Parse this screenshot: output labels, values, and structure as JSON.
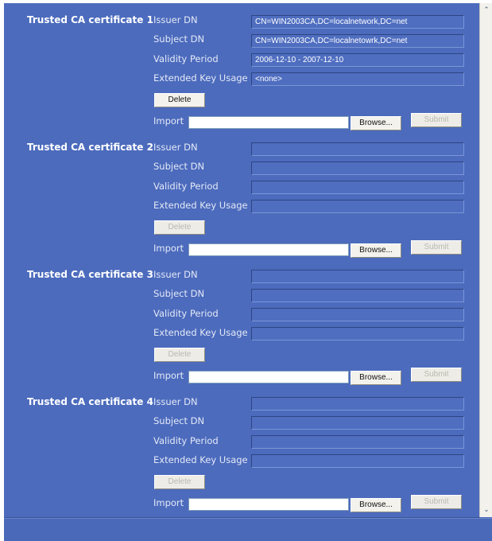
{
  "labels": {
    "issuer_dn": "Issuer DN",
    "subject_dn": "Subject DN",
    "validity_period": "Validity Period",
    "extended_key_usage": "Extended Key Usage",
    "delete": "Delete",
    "import": "Import",
    "browse": "Browse...",
    "submit": "Submit"
  },
  "certificates": [
    {
      "title": "Trusted CA certificate 1",
      "issuer_dn": "CN=WIN2003CA,DC=localnetwork,DC=net",
      "subject_dn": "CN=WIN2003CA,DC=localnetowrk,DC=net",
      "validity_period": "2006-12-10 - 2007-12-10",
      "extended_key_usage": "<none>",
      "delete_enabled": true,
      "submit_enabled": false
    },
    {
      "title": "Trusted CA certificate 2",
      "issuer_dn": "",
      "subject_dn": "",
      "validity_period": "",
      "extended_key_usage": "",
      "delete_enabled": false,
      "submit_enabled": false
    },
    {
      "title": "Trusted CA certificate 3",
      "issuer_dn": "",
      "subject_dn": "",
      "validity_period": "",
      "extended_key_usage": "",
      "delete_enabled": false,
      "submit_enabled": false
    },
    {
      "title": "Trusted CA certificate 4",
      "issuer_dn": "",
      "subject_dn": "",
      "validity_period": "",
      "extended_key_usage": "",
      "delete_enabled": false,
      "submit_enabled": false
    }
  ],
  "scrollbar": {
    "up_glyph": "⌃",
    "down_glyph": "⌄"
  }
}
